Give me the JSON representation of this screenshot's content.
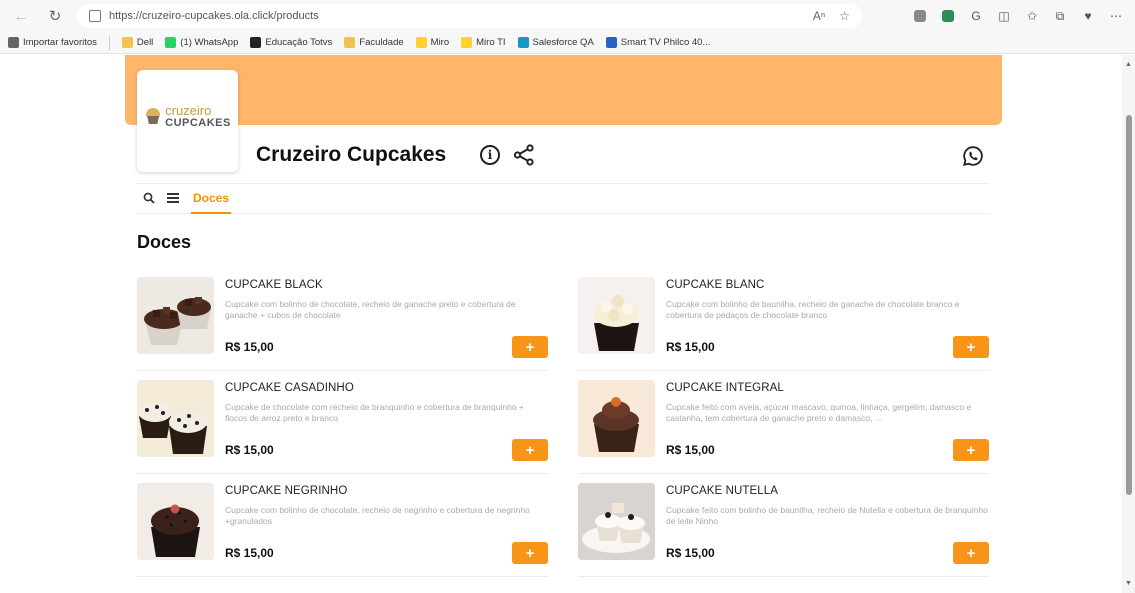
{
  "browser": {
    "url": "https://cruzeiro-cupcakes.ola.click/products",
    "bookmarks": [
      {
        "label": "Importar favoritos",
        "color": "#666"
      },
      {
        "label": "Dell",
        "color": "#f2c14e"
      },
      {
        "label": "(1) WhatsApp",
        "color": "#25d366"
      },
      {
        "label": "Educação Totvs",
        "color": "#222"
      },
      {
        "label": "Faculdade",
        "color": "#f2c14e"
      },
      {
        "label": "Miro",
        "color": "#ffd02f"
      },
      {
        "label": "Miro TI",
        "color": "#ffd02f"
      },
      {
        "label": "Salesforce QA",
        "color": "#1798c1"
      },
      {
        "label": "Smart TV Philco 40...",
        "color": "#2a62c9"
      }
    ]
  },
  "store": {
    "logo_line1": "cruzeiro",
    "logo_line2": "CUPCAKES",
    "title": "Cruzeiro Cupcakes",
    "banner_color": "#ffb66b",
    "accent_color": "#f89418"
  },
  "nav": {
    "active_tab": "Doces"
  },
  "section": {
    "title": "Doces"
  },
  "products": [
    {
      "name": "CUPCAKE BLACK",
      "desc": "Cupcake com bolinho de chocolate, recheio de ganache preto e cobertura de ganache + cubos de chocolate",
      "price": "R$ 15,00",
      "add": "+"
    },
    {
      "name": "CUPCAKE BLANC",
      "desc": "Cupcake com bolinho de baunilha, recheio de ganache de chocolate branco e cobertura de pedaços de chocolate branco",
      "price": "R$ 15,00",
      "add": "+"
    },
    {
      "name": "CUPCAKE CASADINHO",
      "desc": "Cupcake de chocolate com recheio de branquinho e cobertura de branquinho + flocos de arroz preto e branco",
      "price": "R$ 15,00",
      "add": "+"
    },
    {
      "name": "CUPCAKE INTEGRAL",
      "desc": "Cupcake feito com aveia, açúcar mascavo, quinoa, linhaça, gergelim, damasco e castanha, tem cobertura de ganache preto e damasco, ...",
      "price": "R$ 15,00",
      "add": "+"
    },
    {
      "name": "CUPCAKE NEGRINHO",
      "desc": "Cupcake com bolinho de chocolate, recheio de negrinho e cobertura de negrinho +granulados",
      "price": "R$ 15,00",
      "add": "+"
    },
    {
      "name": "CUPCAKE NUTELLA",
      "desc": "Cupcake feito com bolinho de baunilha, recheio de Nutella e cobertura de branquinho de leite Ninho",
      "price": "R$ 15,00",
      "add": "+"
    }
  ]
}
